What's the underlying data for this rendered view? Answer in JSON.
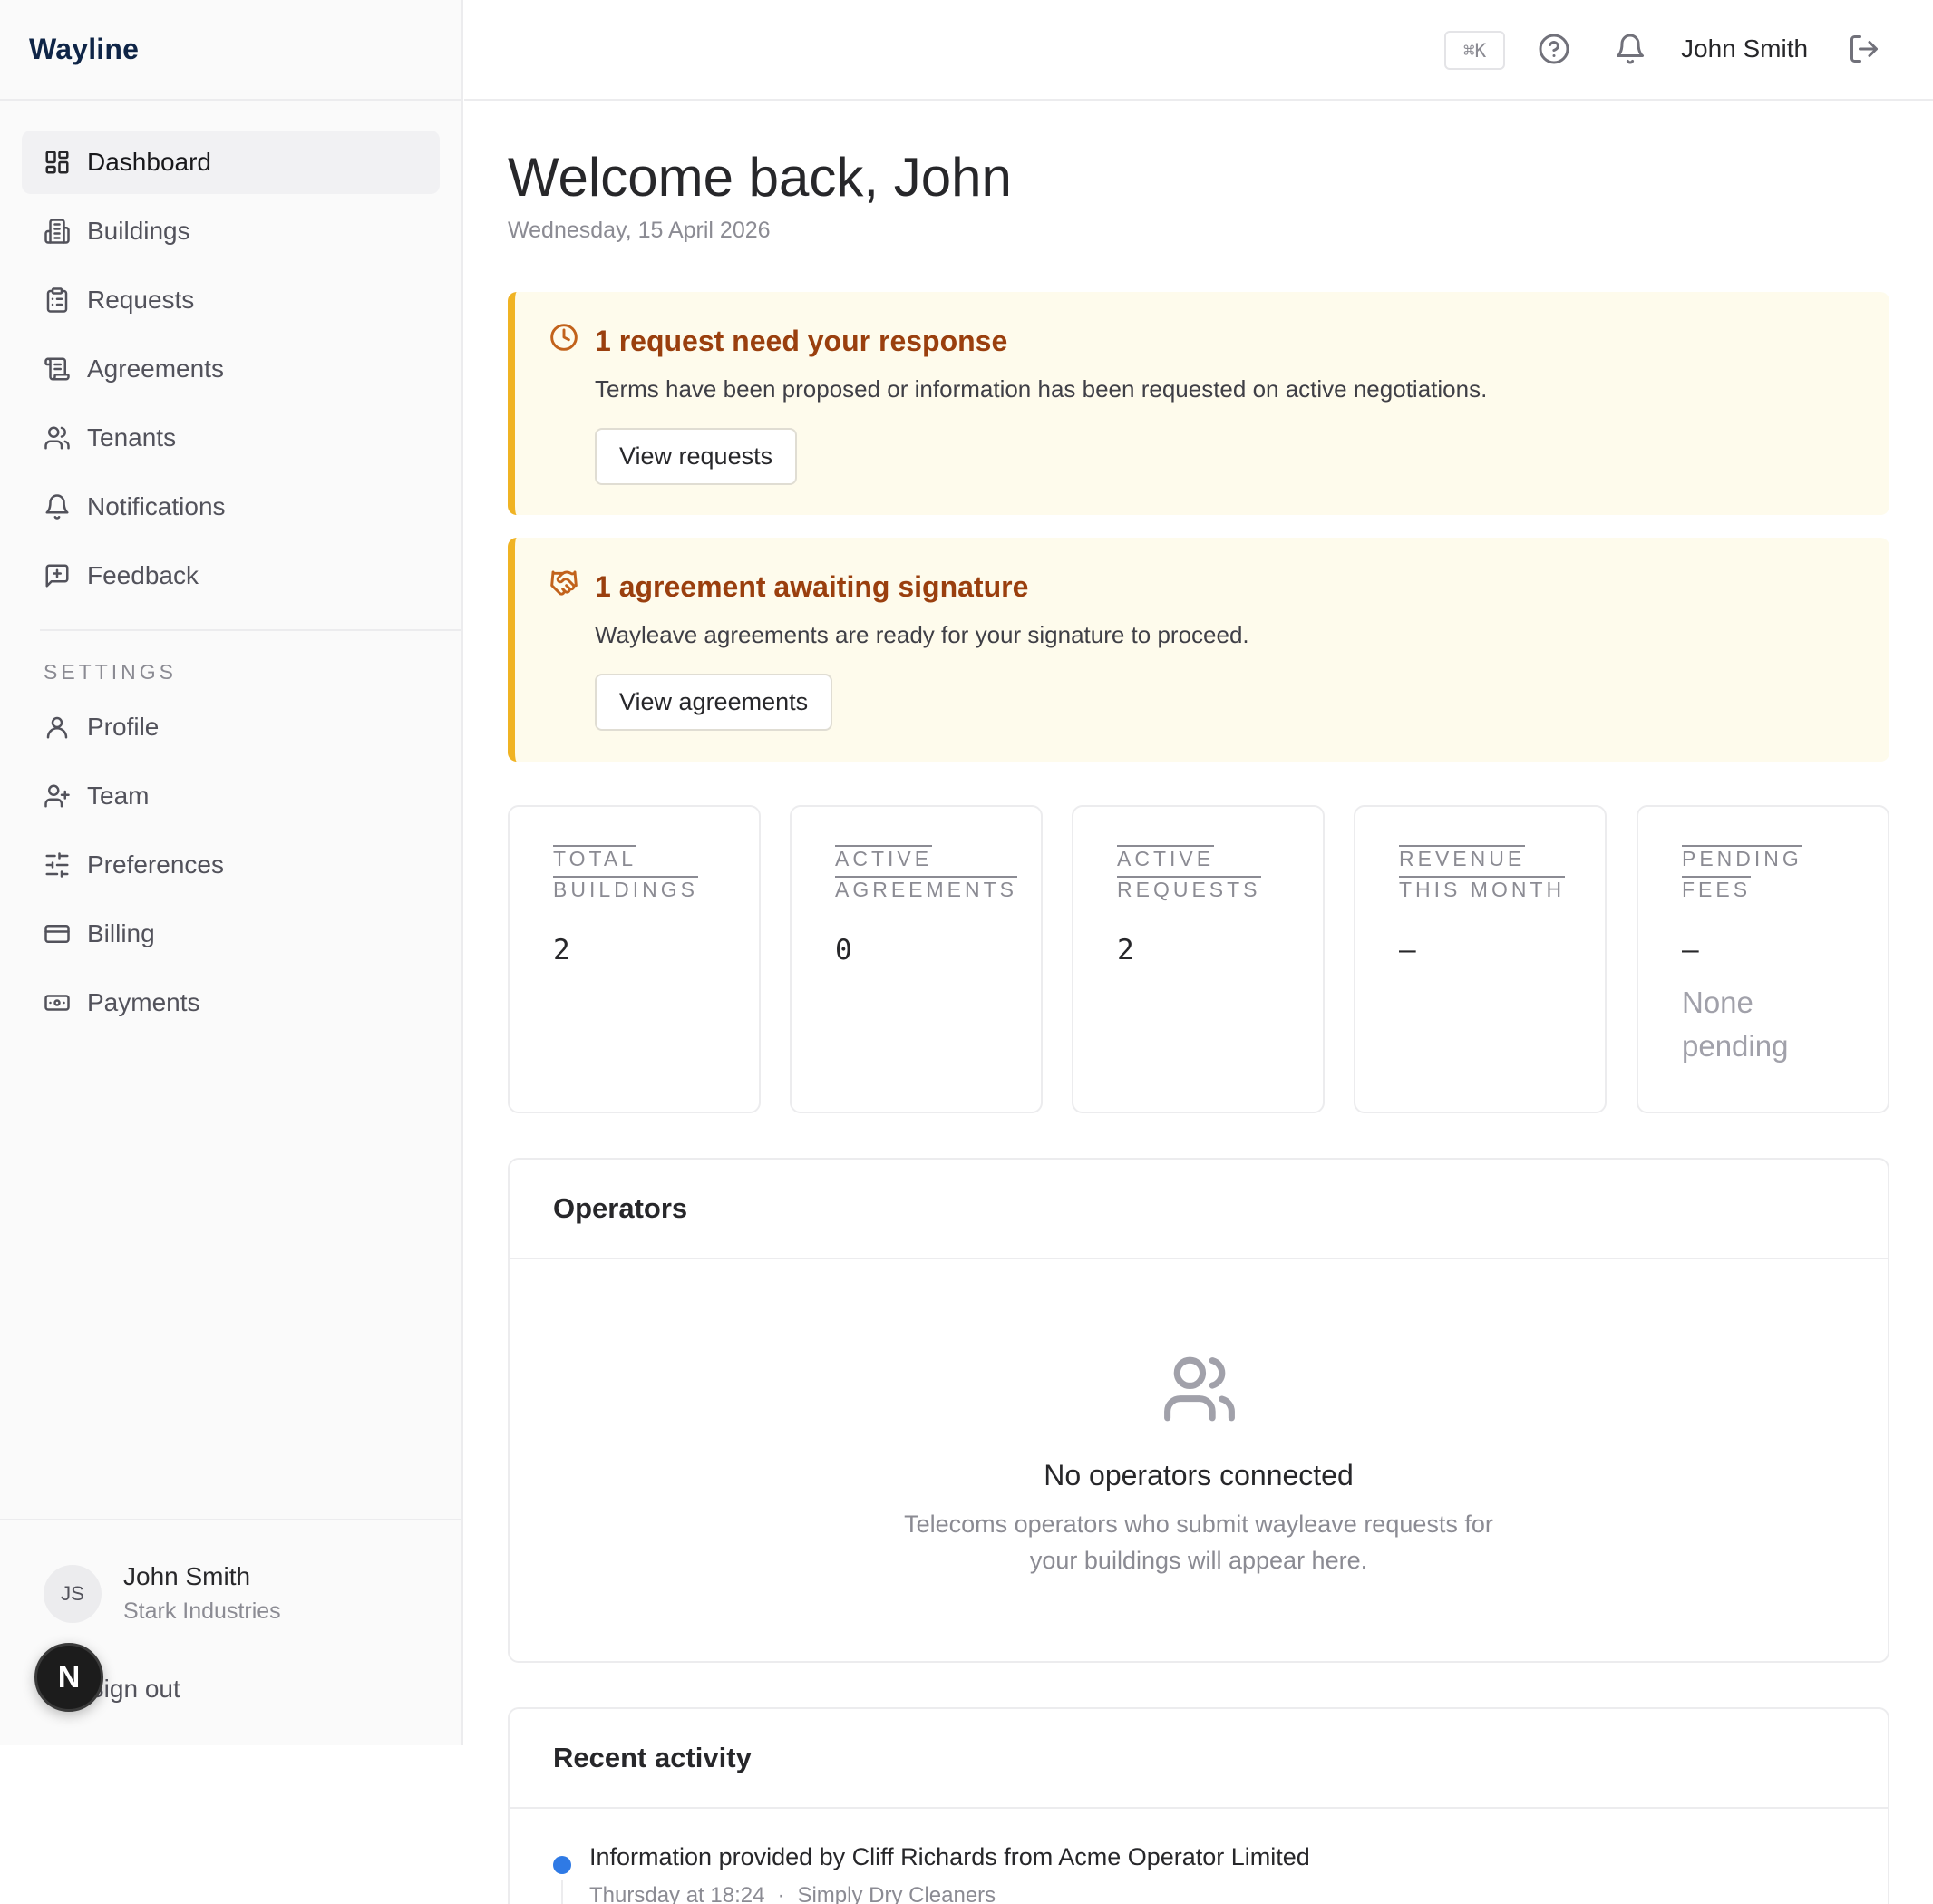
{
  "app": {
    "name": "Wayline"
  },
  "sidebar": {
    "nav": [
      {
        "label": "Dashboard",
        "icon": "dashboard-icon",
        "active": true
      },
      {
        "label": "Buildings",
        "icon": "building-icon"
      },
      {
        "label": "Requests",
        "icon": "clipboard-icon"
      },
      {
        "label": "Agreements",
        "icon": "scroll-icon"
      },
      {
        "label": "Tenants",
        "icon": "users-icon"
      },
      {
        "label": "Notifications",
        "icon": "bell-icon"
      },
      {
        "label": "Feedback",
        "icon": "message-plus-icon"
      }
    ],
    "settings_label": "SETTINGS",
    "settings": [
      {
        "label": "Profile",
        "icon": "user-icon"
      },
      {
        "label": "Team",
        "icon": "user-plus-icon"
      },
      {
        "label": "Preferences",
        "icon": "sliders-icon"
      },
      {
        "label": "Billing",
        "icon": "credit-card-icon"
      },
      {
        "label": "Payments",
        "icon": "banknote-icon"
      }
    ],
    "user": {
      "initials": "JS",
      "name": "John Smith",
      "org": "Stark Industries"
    },
    "signout": "Sign out",
    "badge": "N"
  },
  "topbar": {
    "shortcut": "⌘K",
    "user_name": "John Smith"
  },
  "main": {
    "welcome": "Welcome back, John",
    "date": "Wednesday, 15 April 2026",
    "alerts": [
      {
        "icon": "clock-icon",
        "title": "1 request need your response",
        "description": "Terms have been proposed or information has been requested on active negotiations.",
        "button": "View requests"
      },
      {
        "icon": "handshake-icon",
        "title": "1 agreement awaiting signature",
        "description": "Wayleave agreements are ready for your signature to proceed.",
        "button": "View agreements"
      }
    ],
    "stats": [
      {
        "label_1": "TOTAL",
        "label_2": "BUILDINGS",
        "value": "2",
        "sub": ""
      },
      {
        "label_1": "ACTIVE",
        "label_2": "AGREEMENTS",
        "value": "0",
        "sub": ""
      },
      {
        "label_1": "ACTIVE",
        "label_2": "REQUESTS",
        "value": "2",
        "sub": ""
      },
      {
        "label_1": "REVENUE",
        "label_2": "THIS MONTH",
        "value": "—",
        "sub": ""
      },
      {
        "label_1": "PENDING",
        "label_2": "FEES",
        "value": "—",
        "sub": "None pending"
      }
    ],
    "operators": {
      "title": "Operators",
      "empty_title": "No operators connected",
      "empty_desc_1": "Telecoms operators who submit wayleave requests for",
      "empty_desc_2": "your buildings will appear here."
    },
    "activity": {
      "title": "Recent activity",
      "items": [
        {
          "text": "Information provided by Cliff Richards from Acme Operator Limited",
          "time": "Thursday at 18:24",
          "separator": "·",
          "building": "Simply Dry Cleaners",
          "dot_color": "#2f7ae5"
        }
      ]
    }
  }
}
